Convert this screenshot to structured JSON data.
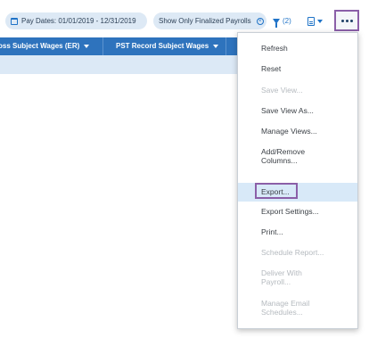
{
  "toolbar": {
    "pay_dates_chip": "Pay Dates: 01/01/2019 - 12/31/2019",
    "finalized_chip": "Show Only Finalized Payrolls",
    "filter_count": "(2)",
    "icons": {
      "calendar": "calendar-icon",
      "clear": "clear-filter-icon",
      "filter": "filter-icon",
      "document": "document-icon",
      "more": "more-options-icon"
    }
  },
  "grid": {
    "columns": [
      {
        "label": "oss Subject Wages (ER)"
      },
      {
        "label": "PST Record Subject Wages"
      }
    ]
  },
  "menu": {
    "items": [
      {
        "label_lines": [
          "Refresh"
        ],
        "enabled": true
      },
      {
        "label_lines": [
          "Reset"
        ],
        "enabled": true
      },
      {
        "label_lines": [
          "Save View..."
        ],
        "enabled": false
      },
      {
        "label_lines": [
          "Save View As..."
        ],
        "enabled": true
      },
      {
        "label_lines": [
          "Manage Views..."
        ],
        "enabled": true
      },
      {
        "label_lines": [
          "Add/Remove",
          "Columns..."
        ],
        "enabled": true
      },
      {
        "label_lines": [
          "Export..."
        ],
        "enabled": true,
        "highlighted": true
      },
      {
        "label_lines": [
          "Export Settings..."
        ],
        "enabled": true
      },
      {
        "label_lines": [
          "Print..."
        ],
        "enabled": true
      },
      {
        "label_lines": [
          "Schedule Report..."
        ],
        "enabled": false
      },
      {
        "label_lines": [
          "Deliver With",
          "Payroll..."
        ],
        "enabled": false
      },
      {
        "label_lines": [
          "Manage Email",
          "Schedules..."
        ],
        "enabled": false
      }
    ]
  },
  "colors": {
    "header_blue": "#2e73bd",
    "highlight": "#8b5fa8",
    "accent": "#1f73c7"
  }
}
